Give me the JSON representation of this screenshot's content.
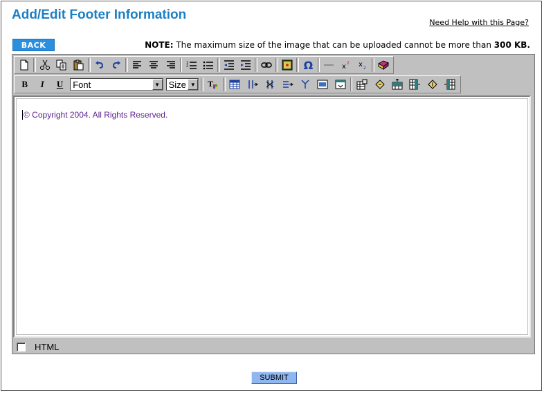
{
  "page": {
    "title": "Add/Edit Footer Information",
    "help_link": "Need Help with this Page?"
  },
  "actions": {
    "back_label": "BACK",
    "submit_label": "SUBMIT"
  },
  "note": {
    "label": "NOTE:",
    "text": " The maximum size of the image that can be uploaded cannot be more than ",
    "limit": "300 KB",
    "end": "."
  },
  "toolbar": {
    "row1_icons": [
      "new-document-icon",
      "cut-icon",
      "copy-icon",
      "paste-icon",
      "undo-icon",
      "redo-icon",
      "align-left-icon",
      "align-center-icon",
      "align-right-icon",
      "numbered-list-icon",
      "bulleted-list-icon",
      "outdent-icon",
      "indent-icon",
      "link-icon",
      "image-icon",
      "special-character-icon",
      "horizontal-rule-icon",
      "superscript-icon",
      "subscript-icon",
      "spellcheck-icon"
    ],
    "bold": "B",
    "italic": "I",
    "underline": "U",
    "font_select": "Font",
    "size_select": "Size",
    "omega": "Ω"
  },
  "editor": {
    "content": "© Copyright 2004. All Rights Reserved.",
    "content_color": "#5a1f8a"
  },
  "status_bar": {
    "html_label": "HTML",
    "html_checked": false
  },
  "colors": {
    "title": "#1c7fc4",
    "back_button": "#2a8fdf",
    "submit_button": "#8fb6ef",
    "toolbar_bg": "#c0c0c0"
  }
}
